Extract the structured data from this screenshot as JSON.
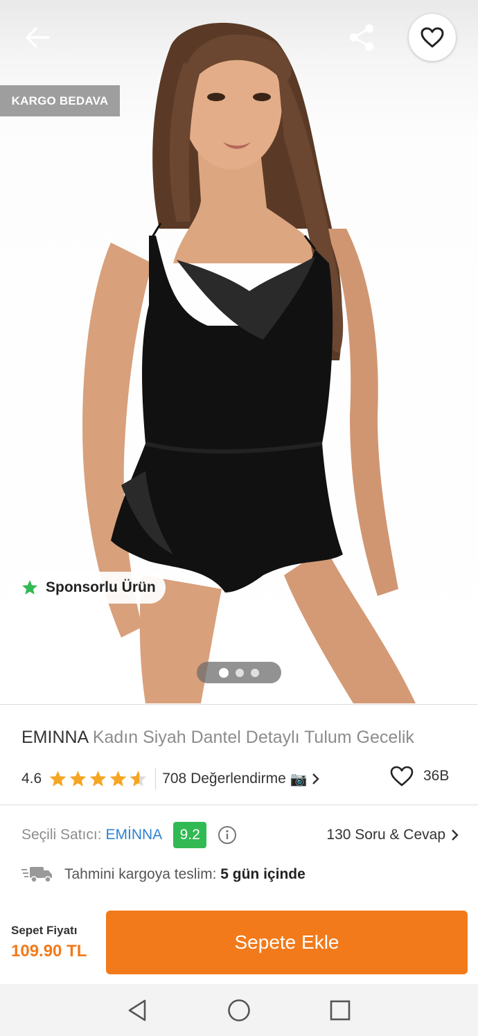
{
  "hero": {
    "cargo_badge": "KARGO BEDAVA",
    "sponsored_label": "Sponsorlu Ürün",
    "image_count": 3,
    "active_image": 1
  },
  "product": {
    "brand": "EMINNA",
    "name": "Kadın Siyah Dantel Detaylı Tulum Gecelik",
    "rating": "4.6",
    "rating_value": 4.6,
    "reviews_label": "708 Değerlendirme",
    "camera_glyph": "📷",
    "likes": "36B"
  },
  "seller": {
    "label": "Seçili Satıcı:",
    "name": "EMİNNA",
    "score": "9.2",
    "qa_label": "130 Soru & Cevap"
  },
  "delivery": {
    "label": "Tahmini kargoya teslim:",
    "value": "5 gün içinde"
  },
  "cart": {
    "price_label": "Sepet Fiyatı",
    "price": "109.90 TL",
    "add_button": "Sepete Ekle"
  },
  "colors": {
    "accent": "#f27a1a",
    "seller_blue": "#2f82d2",
    "score_green": "#31ba53",
    "star": "#f5a623",
    "sponsored_star": "#31ba53"
  },
  "icons": [
    "arrow-left-icon",
    "share-icon",
    "heart-icon",
    "star-icon",
    "camera-icon",
    "chevron-right-icon",
    "info-icon",
    "truck-icon",
    "nav-back-icon",
    "nav-home-icon",
    "nav-recents-icon"
  ]
}
